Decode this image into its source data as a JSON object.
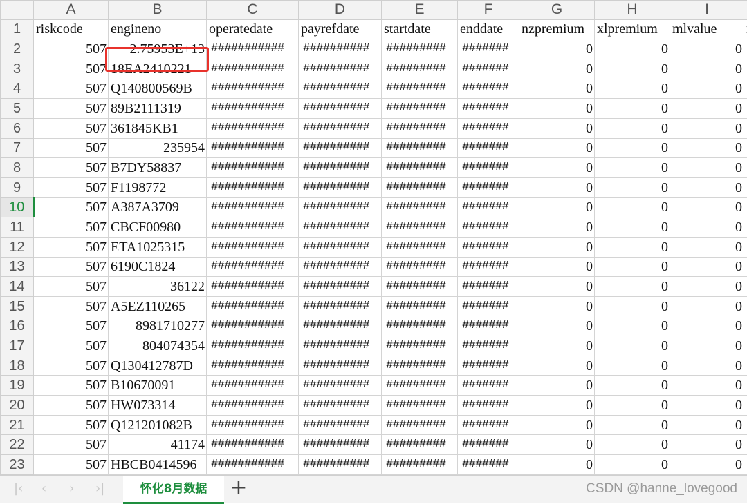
{
  "columns": [
    "A",
    "B",
    "C",
    "D",
    "E",
    "F",
    "G",
    "H",
    "I"
  ],
  "header_row": {
    "number": "1",
    "cells": [
      "riskcode",
      "engineno",
      "operatedate",
      "payrefdate",
      "startdate",
      "enddate",
      "nzpremium",
      "xlpremium",
      "mlvalue"
    ],
    "partial_cell": "n"
  },
  "active_row": "10",
  "highlighted_cell": "B2",
  "rows": [
    {
      "n": "2",
      "riskcode": "507",
      "engineno": "2.75953E+13",
      "engineno_align": "right"
    },
    {
      "n": "3",
      "riskcode": "507",
      "engineno": "18EA2410221",
      "engineno_align": "left"
    },
    {
      "n": "4",
      "riskcode": "507",
      "engineno": "Q140800569B",
      "engineno_align": "left"
    },
    {
      "n": "5",
      "riskcode": "507",
      "engineno": "89B2111319",
      "engineno_align": "left"
    },
    {
      "n": "6",
      "riskcode": "507",
      "engineno": "361845KB1",
      "engineno_align": "left"
    },
    {
      "n": "7",
      "riskcode": "507",
      "engineno": "235954",
      "engineno_align": "right"
    },
    {
      "n": "8",
      "riskcode": "507",
      "engineno": "B7DY58837",
      "engineno_align": "left"
    },
    {
      "n": "9",
      "riskcode": "507",
      "engineno": "F1198772",
      "engineno_align": "left"
    },
    {
      "n": "10",
      "riskcode": "507",
      "engineno": "A387A3709",
      "engineno_align": "left"
    },
    {
      "n": "11",
      "riskcode": "507",
      "engineno": "CBCF00980",
      "engineno_align": "left"
    },
    {
      "n": "12",
      "riskcode": "507",
      "engineno": "ETA1025315",
      "engineno_align": "left"
    },
    {
      "n": "13",
      "riskcode": "507",
      "engineno": "6190C1824",
      "engineno_align": "left"
    },
    {
      "n": "14",
      "riskcode": "507",
      "engineno": "36122",
      "engineno_align": "right"
    },
    {
      "n": "15",
      "riskcode": "507",
      "engineno": "A5EZ110265",
      "engineno_align": "left"
    },
    {
      "n": "16",
      "riskcode": "507",
      "engineno": "8981710277",
      "engineno_align": "right"
    },
    {
      "n": "17",
      "riskcode": "507",
      "engineno": "804074354",
      "engineno_align": "right"
    },
    {
      "n": "18",
      "riskcode": "507",
      "engineno": "Q130412787D",
      "engineno_align": "left"
    },
    {
      "n": "19",
      "riskcode": "507",
      "engineno": "B10670091",
      "engineno_align": "left"
    },
    {
      "n": "20",
      "riskcode": "507",
      "engineno": "HW073314",
      "engineno_align": "left"
    },
    {
      "n": "21",
      "riskcode": "507",
      "engineno": "Q121201082B",
      "engineno_align": "left"
    },
    {
      "n": "22",
      "riskcode": "507",
      "engineno": "41174",
      "engineno_align": "right"
    },
    {
      "n": "23",
      "riskcode": "507",
      "engineno": "HBCB0414596",
      "engineno_align": "left"
    }
  ],
  "overflow_display": {
    "operatedate": "###########",
    "payrefdate": "##########",
    "startdate": "#########",
    "enddate": "#######"
  },
  "zero_value": "0",
  "sheet_tabs": {
    "active": "怀化8月数据",
    "add_icon": "plus-icon"
  },
  "nav_icons": [
    "first-sheet-icon",
    "prev-sheet-icon",
    "next-sheet-icon",
    "last-sheet-icon"
  ],
  "watermark": "CSDN @hanne_lovegood",
  "colors": {
    "active_green": "#1e8e3e",
    "highlight_red": "#e8322c",
    "header_bg": "#f3f3f3"
  }
}
